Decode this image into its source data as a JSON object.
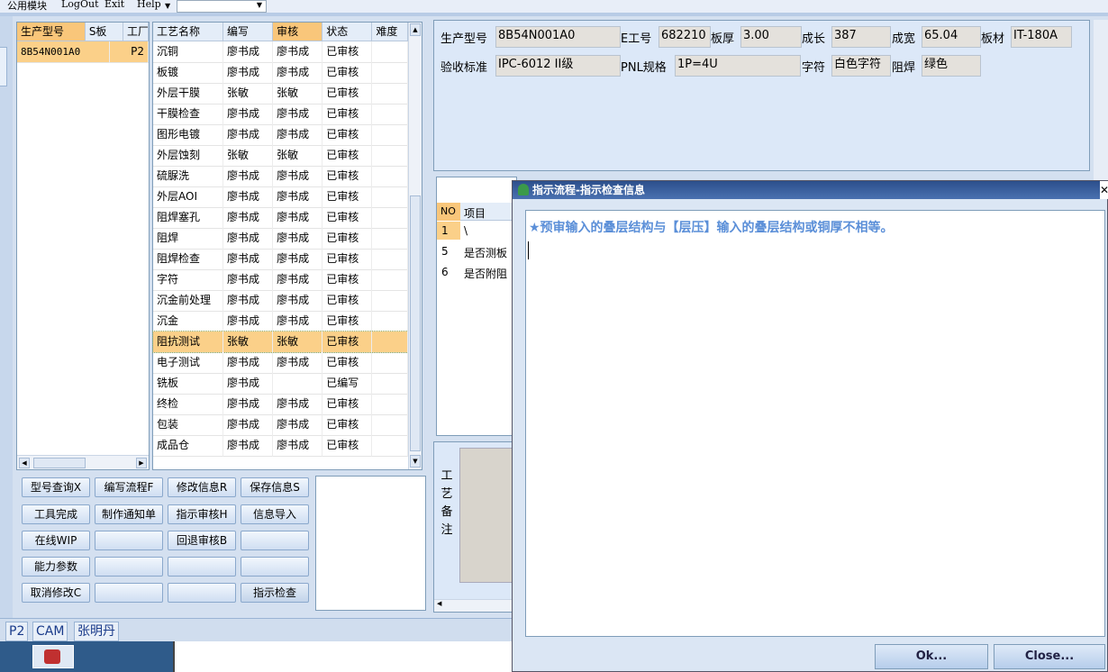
{
  "menubar": {
    "items": [
      "公用模块",
      "LogOut",
      "Exit",
      "Help"
    ]
  },
  "product_table": {
    "headers": [
      "生产型号",
      "S板",
      "工厂"
    ],
    "rows": [
      {
        "model": "8B54N001A0",
        "factory": "P2"
      }
    ]
  },
  "process_table": {
    "headers": [
      "工艺名称",
      "编写",
      "审核",
      "状态",
      "难度"
    ],
    "rows": [
      [
        "沉铜",
        "廖书成",
        "廖书成",
        "已审核"
      ],
      [
        "板镀",
        "廖书成",
        "廖书成",
        "已审核"
      ],
      [
        "外层干膜",
        "张敏",
        "张敏",
        "已审核"
      ],
      [
        "干膜检查",
        "廖书成",
        "廖书成",
        "已审核"
      ],
      [
        "图形电镀",
        "廖书成",
        "廖书成",
        "已审核"
      ],
      [
        "外层蚀刻",
        "张敏",
        "张敏",
        "已审核"
      ],
      [
        "硫脲洗",
        "廖书成",
        "廖书成",
        "已审核"
      ],
      [
        "外层AOI",
        "廖书成",
        "廖书成",
        "已审核"
      ],
      [
        "阻焊塞孔",
        "廖书成",
        "廖书成",
        "已审核"
      ],
      [
        "阻焊",
        "廖书成",
        "廖书成",
        "已审核"
      ],
      [
        "阻焊检查",
        "廖书成",
        "廖书成",
        "已审核"
      ],
      [
        "字符",
        "廖书成",
        "廖书成",
        "已审核"
      ],
      [
        "沉金前处理",
        "廖书成",
        "廖书成",
        "已审核"
      ],
      [
        "沉金",
        "廖书成",
        "廖书成",
        "已审核"
      ],
      [
        "阻抗测试",
        "张敏",
        "张敏",
        "已审核"
      ],
      [
        "电子测试",
        "廖书成",
        "廖书成",
        "已审核"
      ],
      [
        "铣板",
        "廖书成",
        "",
        "已编写"
      ],
      [
        "终检",
        "廖书成",
        "廖书成",
        "已审核"
      ],
      [
        "包装",
        "廖书成",
        "廖书成",
        "已审核"
      ],
      [
        "成品仓",
        "廖书成",
        "廖书成",
        "已审核"
      ]
    ],
    "selected_index": 14
  },
  "buttons": [
    [
      "型号查询X",
      "编写流程F",
      "修改信息R",
      "保存信息S"
    ],
    [
      "工具完成",
      "制作通知单",
      "指示审核H",
      "信息导入"
    ],
    [
      "在线WIP",
      "",
      "回退审核B",
      ""
    ],
    [
      "能力参数",
      "",
      "",
      ""
    ],
    [
      "取消修改C",
      "",
      "",
      "指示检查"
    ]
  ],
  "info": {
    "model_label": "生产型号",
    "model": "8B54N001A0",
    "e_label": "E工号",
    "e_no": "682210",
    "thick_label": "板厚",
    "thick": "3.00",
    "len_label": "成长",
    "len": "387",
    "width_label": "成宽",
    "width": "65.04",
    "mat_label": "板材",
    "mat": "IT-180A",
    "std_label": "验收标准",
    "std": "IPC-6012 II级",
    "pnl_label": "PNL规格",
    "pnl": "1P=4U",
    "char_label": "字符",
    "char": "白色字符",
    "mask_label": "阻焊",
    "mask": "绿色"
  },
  "check_items": {
    "headers": [
      "NO",
      "项目"
    ],
    "rows": [
      [
        "1",
        "\\"
      ],
      [
        "5",
        "是否测板"
      ],
      [
        "6",
        "是否附阻"
      ]
    ]
  },
  "remark_label": [
    "工",
    "艺",
    "备",
    "注"
  ],
  "status": [
    "P2",
    "CAM",
    "张明丹"
  ],
  "dialog": {
    "title": "指示流程-指示检查信息",
    "message": "★预审输入的叠层结构与【层压】输入的叠层结构或铜厚不相等。",
    "ok": "Ok...",
    "close": "Close..."
  }
}
